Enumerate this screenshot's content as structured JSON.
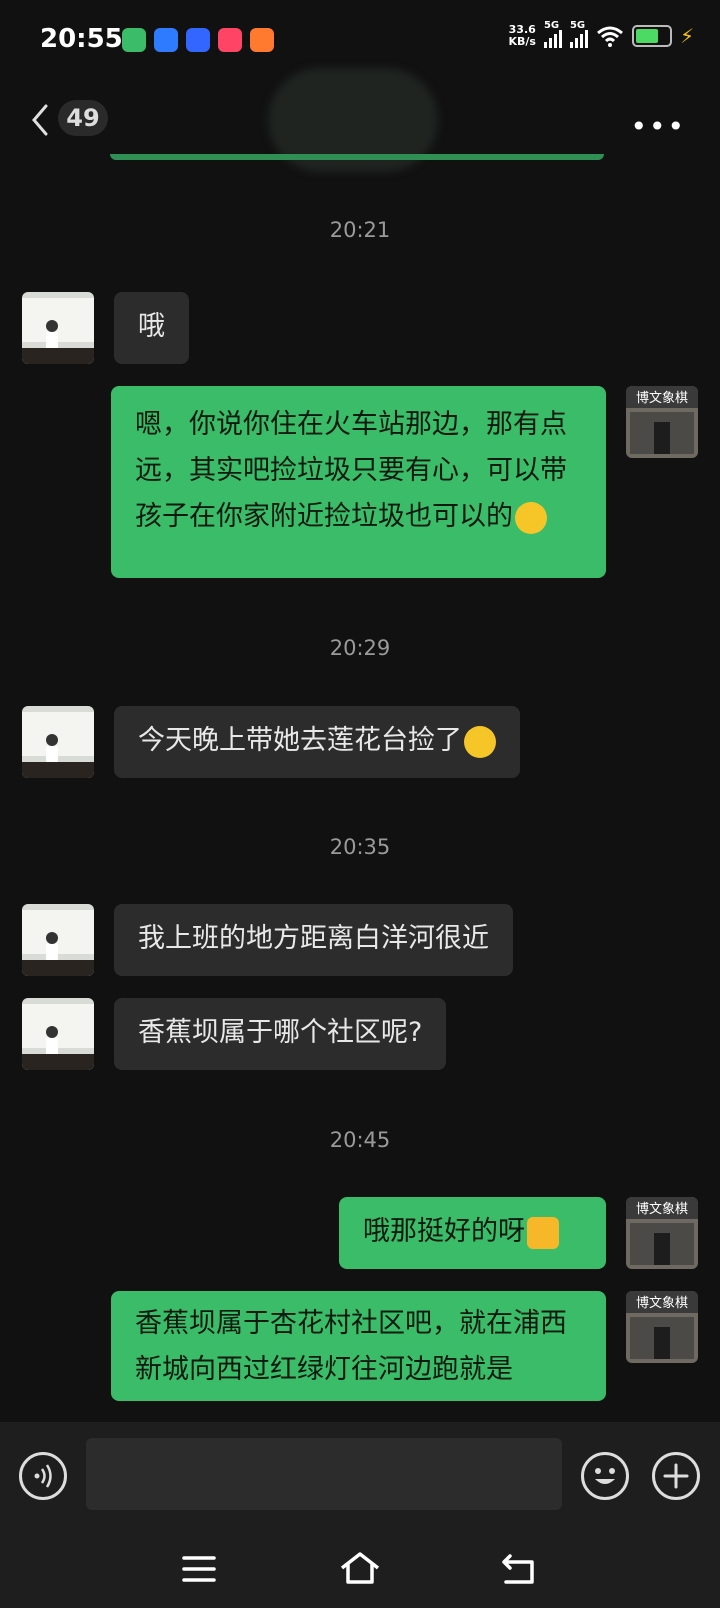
{
  "status_bar": {
    "time": "20:55",
    "net_speed_value": "33.6",
    "net_speed_unit": "KB/s",
    "signal1_label": "5G",
    "signal2_label": "5G",
    "battery_color": "#4cd964"
  },
  "header": {
    "back_icon": "chevron-left-icon",
    "unread_count": "49",
    "more_icon": "more-dots-icon"
  },
  "messages": [
    {
      "type": "timestamp",
      "text": "20:21"
    },
    {
      "type": "in",
      "text": "哦"
    },
    {
      "type": "out",
      "text": "嗯，你说你住在火车站那边，那有点远，其实吧捡垃圾只要有心，可以带孩子在你家附近捡垃圾也可以的",
      "emoji": "smile-emoji"
    },
    {
      "type": "timestamp",
      "text": "20:29"
    },
    {
      "type": "in",
      "text": "今天晚上带她去莲花台捡了",
      "emoji": "smile-emoji"
    },
    {
      "type": "timestamp",
      "text": "20:35"
    },
    {
      "type": "in",
      "text": "我上班的地方距离白洋河很近"
    },
    {
      "type": "in",
      "text": "香蕉坝属于哪个社区呢?"
    },
    {
      "type": "timestamp",
      "text": "20:45"
    },
    {
      "type": "out",
      "text": "哦那挺好的呀",
      "emoji": "thumbs-up-emoji"
    },
    {
      "type": "out",
      "text": "香蕉坝属于杏花村社区吧，就在浦西新城向西过红绿灯往河边跑就是"
    }
  ],
  "my_avatar_sign": "博文象棋",
  "composer": {
    "voice_icon": "voice-icon",
    "emoji_icon": "emoji-icon",
    "plus_icon": "plus-icon",
    "input_value": ""
  },
  "system_nav": {
    "menu_icon": "menu-icon",
    "home_icon": "home-icon",
    "back_icon": "back-icon"
  },
  "colors": {
    "background": "#111111",
    "incoming_bubble": "#2c2c2c",
    "outgoing_bubble": "#3bbc69",
    "timestamp": "#9a9a9a"
  }
}
